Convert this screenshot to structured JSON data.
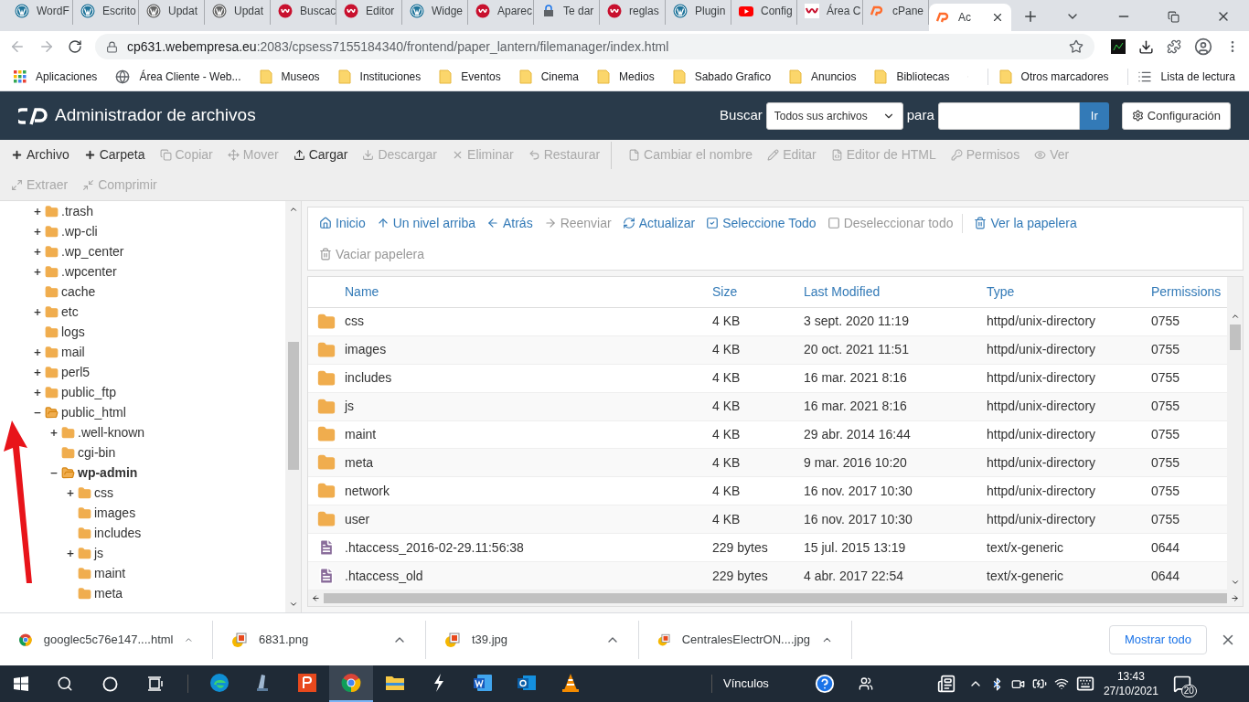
{
  "browser": {
    "tabs": [
      {
        "title": "WordF",
        "kind": "wordpress",
        "selected": false
      },
      {
        "title": "Escrito",
        "kind": "wordpress",
        "selected": false
      },
      {
        "title": "Updat",
        "kind": "wordpress-gray",
        "selected": false
      },
      {
        "title": "Updat",
        "kind": "wordpress-gray",
        "selected": false
      },
      {
        "title": "Buscac",
        "kind": "webempresa",
        "selected": false
      },
      {
        "title": "Editor",
        "kind": "webempresa",
        "selected": false
      },
      {
        "title": "Widge",
        "kind": "wordpress",
        "selected": false
      },
      {
        "title": "Aparec",
        "kind": "webempresa",
        "selected": false
      },
      {
        "title": "Te dar",
        "kind": "lock",
        "selected": false
      },
      {
        "title": "reglas",
        "kind": "webempresa",
        "selected": false
      },
      {
        "title": "Plugin",
        "kind": "wordpress",
        "selected": false
      },
      {
        "title": "Config",
        "kind": "youtube",
        "selected": false
      },
      {
        "title": "Área C",
        "kind": "webempresa-square",
        "selected": false
      },
      {
        "title": "cPane",
        "kind": "cpanel",
        "selected": false
      },
      {
        "title": "Ac",
        "kind": "cpanel",
        "selected": true
      }
    ],
    "url_host": "cp631.webempresa.eu",
    "url_path": ":2083/cpsess7155184340/frontend/paper_lantern/filemanager/index.html",
    "bookmarks": [
      {
        "label": "Aplicaciones",
        "kind": "apps"
      },
      {
        "label": "Área Cliente - Web...",
        "kind": "globe"
      },
      {
        "label": "Museos",
        "kind": "folder"
      },
      {
        "label": "Instituciones",
        "kind": "folder"
      },
      {
        "label": "Eventos",
        "kind": "folder"
      },
      {
        "label": "Cinema",
        "kind": "folder"
      },
      {
        "label": "Medios",
        "kind": "folder"
      },
      {
        "label": "Sabado Grafico",
        "kind": "folder"
      },
      {
        "label": "Anuncios",
        "kind": "folder"
      },
      {
        "label": "Bibliotecas",
        "kind": "folder"
      }
    ],
    "other_bookmarks": "Otros marcadores",
    "reading_list": "Lista de lectura"
  },
  "header": {
    "title": "Administrador de archivos",
    "search_label": "Buscar",
    "scope": "Todos sus archivos",
    "for_label": "para",
    "go": "Ir",
    "settings": "Configuración"
  },
  "toolbar": {
    "rows": [
      [
        [
          {
            "label": "Archivo",
            "kind": "plus",
            "disabled": false
          },
          {
            "label": "Carpeta",
            "kind": "plus",
            "disabled": false
          },
          {
            "label": "Copiar",
            "kind": "copy",
            "disabled": true
          },
          {
            "label": "Mover",
            "kind": "move",
            "disabled": true
          },
          {
            "label": "Cargar",
            "kind": "upload",
            "disabled": false
          },
          {
            "label": "Descargar",
            "kind": "download",
            "disabled": true
          },
          {
            "label": "Eliminar",
            "kind": "close",
            "disabled": true
          },
          {
            "label": "Restaurar",
            "kind": "undo",
            "disabled": true
          }
        ],
        [
          {
            "label": "Cambiar el nombre",
            "kind": "file",
            "disabled": true
          },
          {
            "label": "Editar",
            "kind": "pencil",
            "disabled": true
          },
          {
            "label": "Editor de HTML",
            "kind": "code",
            "disabled": true
          },
          {
            "label": "Permisos",
            "kind": "key",
            "disabled": true
          },
          {
            "label": "Ver",
            "kind": "eye",
            "disabled": true
          }
        ]
      ],
      [
        [
          {
            "label": "Extraer",
            "kind": "expand",
            "disabled": true
          },
          {
            "label": "Comprimir",
            "kind": "compress",
            "disabled": true
          }
        ]
      ]
    ]
  },
  "tree": [
    {
      "name": ".trash",
      "expandable": true,
      "expanded": false,
      "selected": false
    },
    {
      "name": ".wp-cli",
      "expandable": true,
      "expanded": false,
      "selected": false
    },
    {
      "name": ".wp_center",
      "expandable": true,
      "expanded": false,
      "selected": false
    },
    {
      "name": ".wpcenter",
      "expandable": true,
      "expanded": false,
      "selected": false
    },
    {
      "name": "cache",
      "expandable": false,
      "expanded": false,
      "selected": false
    },
    {
      "name": "etc",
      "expandable": true,
      "expanded": false,
      "selected": false
    },
    {
      "name": "logs",
      "expandable": false,
      "expanded": false,
      "selected": false
    },
    {
      "name": "mail",
      "expandable": true,
      "expanded": false,
      "selected": false
    },
    {
      "name": "perl5",
      "expandable": true,
      "expanded": false,
      "selected": false
    },
    {
      "name": "public_ftp",
      "expandable": true,
      "expanded": false,
      "selected": false
    },
    {
      "name": "public_html",
      "expandable": true,
      "expanded": true,
      "selected": false,
      "children": [
        {
          "name": ".well-known",
          "expandable": true,
          "expanded": false,
          "selected": false
        },
        {
          "name": "cgi-bin",
          "expandable": false,
          "expanded": false,
          "selected": false
        },
        {
          "name": "wp-admin",
          "expandable": true,
          "expanded": true,
          "selected": true,
          "children": [
            {
              "name": "css",
              "expandable": true,
              "expanded": false,
              "selected": false
            },
            {
              "name": "images",
              "expandable": false,
              "expanded": false,
              "selected": false
            },
            {
              "name": "includes",
              "expandable": false,
              "expanded": false,
              "selected": false
            },
            {
              "name": "js",
              "expandable": true,
              "expanded": false,
              "selected": false
            },
            {
              "name": "maint",
              "expandable": false,
              "expanded": false,
              "selected": false
            },
            {
              "name": "meta",
              "expandable": false,
              "expanded": false,
              "selected": false
            }
          ]
        }
      ]
    }
  ],
  "nav": [
    [
      {
        "label": "Inicio",
        "kind": "home",
        "disabled": false
      },
      {
        "label": "Un nivel arriba",
        "kind": "up",
        "disabled": false
      },
      {
        "label": "Atrás",
        "kind": "back",
        "disabled": false
      },
      {
        "label": "Reenviar",
        "kind": "forward",
        "disabled": true
      },
      {
        "label": "Actualizar",
        "kind": "refresh",
        "disabled": false
      },
      {
        "label": "Seleccione Todo",
        "kind": "checked",
        "disabled": false
      },
      {
        "label": "Deseleccionar todo",
        "kind": "unchecked",
        "disabled": true
      },
      {
        "label": "Ver la papelera",
        "kind": "trash",
        "disabled": false
      }
    ],
    [
      {
        "label": "Vaciar papelera",
        "kind": "trash",
        "disabled": true
      }
    ]
  ],
  "table": {
    "columns": [
      "Name",
      "Size",
      "Last Modified",
      "Type",
      "Permissions"
    ],
    "rows": [
      {
        "kind": "folder",
        "name": "css",
        "size": "4 KB",
        "modified": "3 sept. 2020 11:19",
        "type": "httpd/unix-directory",
        "perms": "0755"
      },
      {
        "kind": "folder",
        "name": "images",
        "size": "4 KB",
        "modified": "20 oct. 2021 11:51",
        "type": "httpd/unix-directory",
        "perms": "0755"
      },
      {
        "kind": "folder",
        "name": "includes",
        "size": "4 KB",
        "modified": "16 mar. 2021 8:16",
        "type": "httpd/unix-directory",
        "perms": "0755"
      },
      {
        "kind": "folder",
        "name": "js",
        "size": "4 KB",
        "modified": "16 mar. 2021 8:16",
        "type": "httpd/unix-directory",
        "perms": "0755"
      },
      {
        "kind": "folder",
        "name": "maint",
        "size": "4 KB",
        "modified": "29 abr. 2014 16:44",
        "type": "httpd/unix-directory",
        "perms": "0755"
      },
      {
        "kind": "folder",
        "name": "meta",
        "size": "4 KB",
        "modified": "9 mar. 2016 10:20",
        "type": "httpd/unix-directory",
        "perms": "0755"
      },
      {
        "kind": "folder",
        "name": "network",
        "size": "4 KB",
        "modified": "16 nov. 2017 10:30",
        "type": "httpd/unix-directory",
        "perms": "0755"
      },
      {
        "kind": "folder",
        "name": "user",
        "size": "4 KB",
        "modified": "16 nov. 2017 10:30",
        "type": "httpd/unix-directory",
        "perms": "0755"
      },
      {
        "kind": "file",
        "name": ".htaccess_2016-02-29.11:56:38",
        "size": "229 bytes",
        "modified": "15 jul. 2015 13:19",
        "type": "text/x-generic",
        "perms": "0644"
      },
      {
        "kind": "file",
        "name": ".htaccess_old",
        "size": "229 bytes",
        "modified": "4 abr. 2017 22:54",
        "type": "text/x-generic",
        "perms": "0644"
      }
    ]
  },
  "downloads": {
    "items": [
      {
        "name": "googlec5c76e147....html",
        "kind": "chrome"
      },
      {
        "name": "6831.png",
        "kind": "image"
      },
      {
        "name": "t39.jpg",
        "kind": "image"
      },
      {
        "name": "CentralesElectrON....jpg",
        "kind": "image"
      }
    ],
    "show_all": "Mostrar todo"
  },
  "taskbar": {
    "apps": [
      {
        "kind": "edge",
        "active": false
      },
      {
        "kind": "scanner",
        "active": false
      },
      {
        "kind": "pdf",
        "active": false
      },
      {
        "kind": "chrome",
        "active": true
      },
      {
        "kind": "explorer",
        "active": false
      },
      {
        "kind": "bolt",
        "active": false
      },
      {
        "kind": "word",
        "active": false
      },
      {
        "kind": "outlook",
        "active": false
      },
      {
        "kind": "vlc",
        "active": false
      }
    ],
    "links": "Vínculos",
    "time": "13:43",
    "date": "27/10/2021",
    "notifications": "20"
  }
}
